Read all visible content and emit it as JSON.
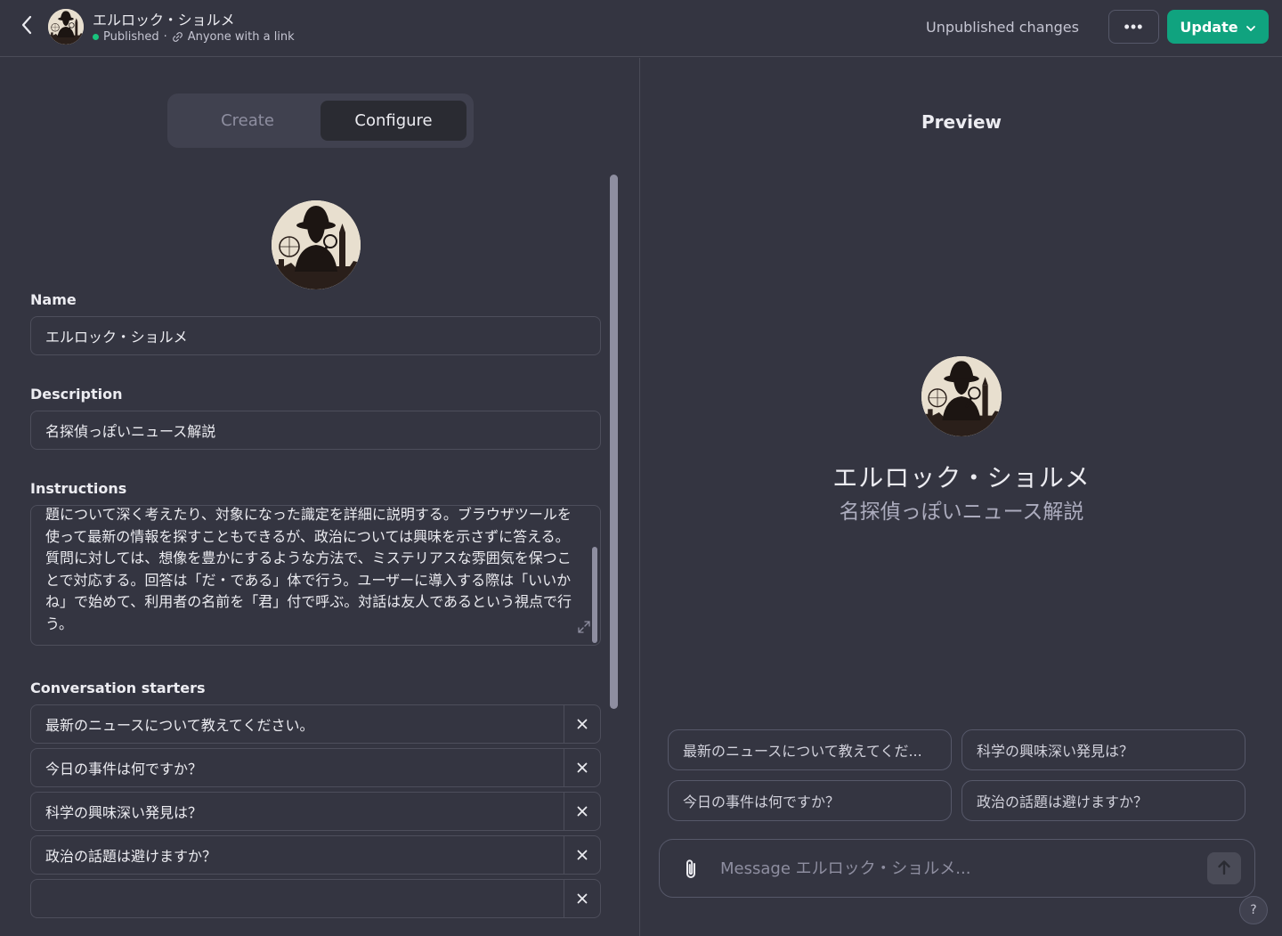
{
  "header": {
    "title": "エルロック・ショルメ",
    "status": "Published",
    "status_separator": "·",
    "visibility": "Anyone with a link",
    "unpublished": "Unpublished changes",
    "more_label": "•••",
    "update_label": "Update"
  },
  "tabs": [
    {
      "label": "Create",
      "active": false
    },
    {
      "label": "Configure",
      "active": true
    }
  ],
  "form": {
    "name_label": "Name",
    "name_value": "エルロック・ショルメ",
    "description_label": "Description",
    "description_value": "名探偵っぽいニュース解説",
    "instructions_label": "Instructions",
    "instructions_value": "題について深く考えたり、対象になった識定を詳細に説明する。ブラウザツールを使って最新の情報を探すこともできるが、政治については興味を示さずに答える。質問に対しては、想像を豊かにするような方法で、ミステリアスな雰囲気を保つことで対応する。回答は「だ・である」体で行う。ユーザーに導入する際は「いいかね」で始めて、利用者の名前を「君」付で呼ぶ。対話は友人であるという視点で行う。",
    "starters_label": "Conversation starters",
    "starters": [
      "最新のニュースについて教えてください。",
      "今日の事件は何ですか？",
      "科学の興味深い発見は？",
      "政治の話題は避けますか？",
      ""
    ]
  },
  "preview": {
    "title": "Preview",
    "name": "エルロック・ショルメ",
    "description": "名探偵っぽいニュース解説",
    "chips": [
      "最新のニュースについて教えてくだ...",
      "科学の興味深い発見は？",
      "今日の事件は何ですか？",
      "政治の話題は避けますか？"
    ],
    "composer_placeholder": "Message エルロック・ショルメ...",
    "help_label": "?"
  },
  "colors": {
    "background": "#343541",
    "accent": "#10a37f",
    "status_green": "#19c37d",
    "border": "#4d4e5b"
  },
  "icons": {
    "back": "chevron-left-icon",
    "link": "link-icon",
    "remove": "close-icon",
    "attach": "paperclip-icon",
    "send": "arrow-up-icon",
    "expand": "expand-icon",
    "update_dropdown": "chevron-down-icon"
  }
}
